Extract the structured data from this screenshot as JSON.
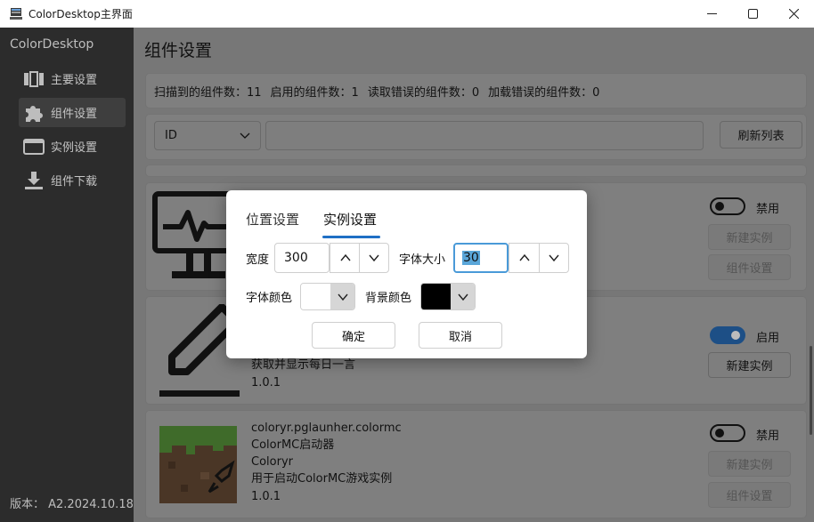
{
  "window": {
    "title": "ColorDesktop主界面",
    "controls": [
      "minimize-icon",
      "maximize-icon",
      "close-icon"
    ]
  },
  "sidebar": {
    "brand": "ColorDesktop",
    "items": [
      {
        "label": "主要设置",
        "icon": "book-icon",
        "active": false
      },
      {
        "label": "组件设置",
        "icon": "puzzle-icon",
        "active": true
      },
      {
        "label": "实例设置",
        "icon": "window-icon",
        "active": false
      },
      {
        "label": "组件下载",
        "icon": "download-icon",
        "active": false
      }
    ],
    "version": "版本：  A2.2024.10.18"
  },
  "main": {
    "page_title": "组件设置",
    "stats": {
      "scanned": "扫描到的组件数：11",
      "enabled": "启用的组件数：1",
      "read_errors": "读取错误的组件数：0",
      "load_errors": "加载错误的组件数：0"
    },
    "filter": {
      "select_value": "ID",
      "search_value": "",
      "refresh_button": "刷新列表"
    },
    "components": [
      {
        "icon": "monitor-icon",
        "toggle_label": "禁用",
        "enabled": false,
        "new_instance": "新建实例",
        "settings": "组件设置"
      },
      {
        "icon": "pen-icon",
        "toggle_label": "启用",
        "enabled": true,
        "new_instance": "新建实例",
        "description": "获取并显示每日一言",
        "version": "1.0.1"
      },
      {
        "icon": "minecraft-icon",
        "id": "coloryr.pglaunher.colormc",
        "name": "ColorMC启动器",
        "author": "Coloryr",
        "description": "用于启动ColorMC游戏实例",
        "version": "1.0.1",
        "toggle_label": "禁用",
        "enabled": false,
        "new_instance": "新建实例",
        "settings": "组件设置"
      }
    ]
  },
  "dialog": {
    "tabs": [
      {
        "label": "位置设置",
        "active": false
      },
      {
        "label": "实例设置",
        "active": true
      }
    ],
    "width_label": "宽度",
    "width_value": "300",
    "font_size_label": "字体大小",
    "font_size_value": "30",
    "font_color_label": "字体颜色",
    "font_color": "#ffffff",
    "bg_color_label": "背景颜色",
    "bg_color": "#000000",
    "confirm": "确定",
    "cancel": "取消"
  },
  "colors": {
    "accent": "#1f6fc5",
    "sidebar_bg": "#2c2c2c",
    "overlay": "#777777"
  }
}
